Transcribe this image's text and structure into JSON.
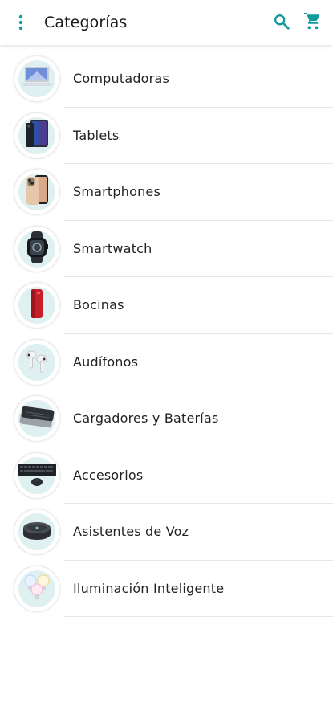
{
  "header": {
    "title": "Categorías",
    "menu_icon": "more-vert-icon",
    "search_icon": "search-icon",
    "cart_icon": "shopping-cart-icon"
  },
  "colors": {
    "accent": "#119a9a",
    "thumb_background": "#dff0f0",
    "divider": "#e6e6e6"
  },
  "categories": [
    {
      "label": "Computadoras",
      "icon": "laptop-icon"
    },
    {
      "label": "Tablets",
      "icon": "tablet-icon"
    },
    {
      "label": "Smartphones",
      "icon": "smartphone-icon"
    },
    {
      "label": "Smartwatch",
      "icon": "smartwatch-icon"
    },
    {
      "label": "Bocinas",
      "icon": "speaker-icon"
    },
    {
      "label": "Audífonos",
      "icon": "earbuds-icon"
    },
    {
      "label": "Cargadores y Baterías",
      "icon": "power-bank-icon"
    },
    {
      "label": "Accesorios",
      "icon": "keyboard-mouse-icon"
    },
    {
      "label": "Asistentes de Voz",
      "icon": "smart-speaker-icon"
    },
    {
      "label": "Iluminación Inteligente",
      "icon": "smart-bulb-icon"
    }
  ]
}
